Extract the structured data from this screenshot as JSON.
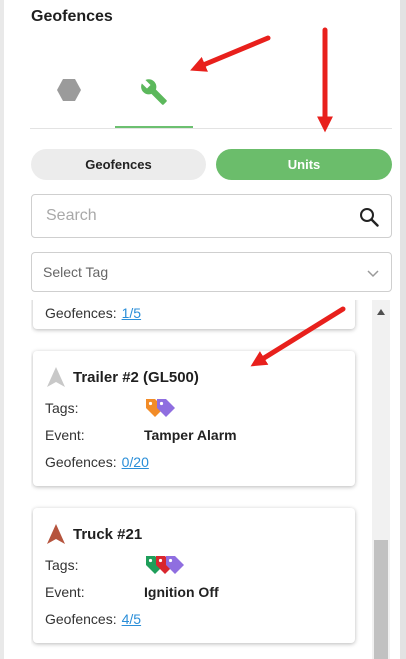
{
  "panel": {
    "title": "Geofences"
  },
  "view_tabs": [
    {
      "icon": "hexagon-icon",
      "active": false
    },
    {
      "icon": "wrench-icon",
      "active": true
    }
  ],
  "segmented": {
    "geofences_label": "Geofences",
    "units_label": "Units",
    "selected": "Units"
  },
  "search": {
    "placeholder": "Search",
    "value": ""
  },
  "tag_select": {
    "label": "Select Tag"
  },
  "labels": {
    "tags": "Tags:",
    "event": "Event:",
    "geofences": "Geofences:"
  },
  "units": [
    {
      "name": "",
      "geofences": "1/5"
    },
    {
      "name": "Trailer #2 (GL500)",
      "icon": "navigation-arrow-icon",
      "event": "Tamper Alarm",
      "geofences": "0/20",
      "tag_colors": [
        "#f28c28",
        "#8f6ee0"
      ]
    },
    {
      "name": "Truck #21",
      "icon": "navigation-arrow-icon",
      "event": "Ignition Off",
      "geofences": "4/5",
      "tag_colors": [
        "#1f9e5a",
        "#d9262e",
        "#8f6ee0"
      ]
    }
  ],
  "colors": {
    "accent": "#6bbd6b",
    "link": "#2a8ed8",
    "annotation_arrow": "#e8201c",
    "trailer_icon": "#c8c8c8",
    "truck_icon": "#b5543d"
  }
}
